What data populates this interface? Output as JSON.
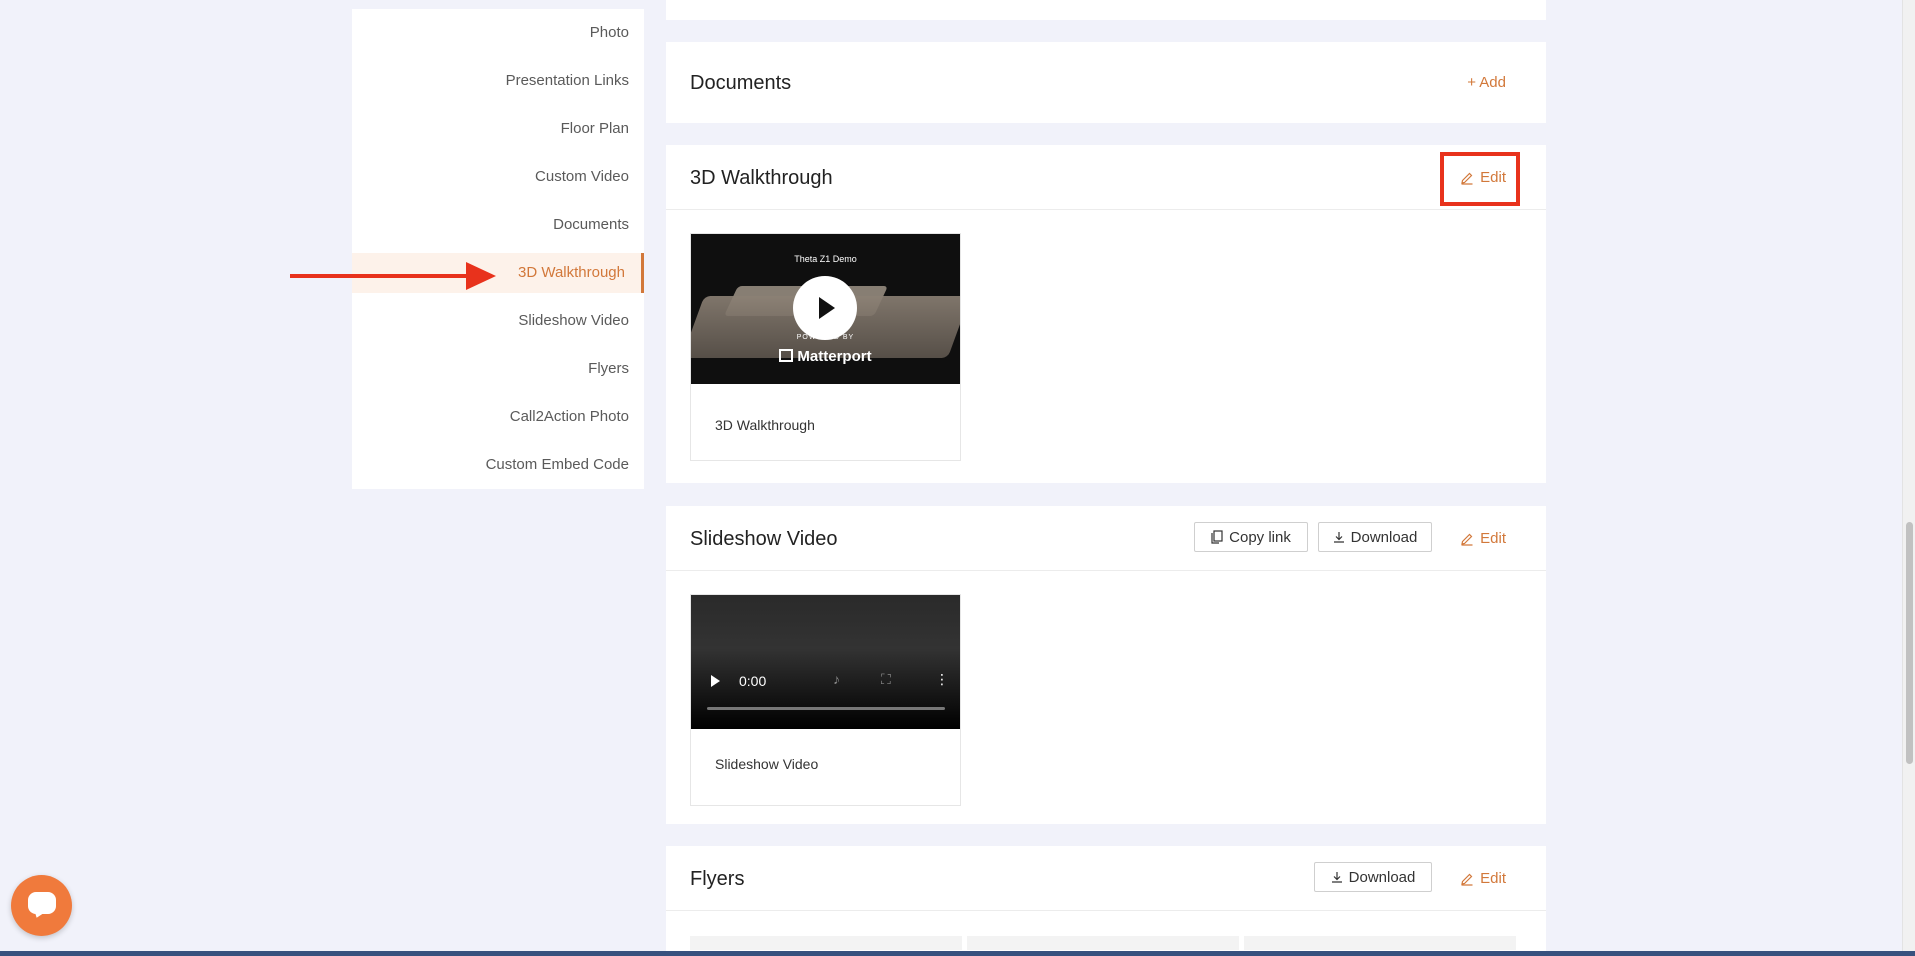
{
  "sidebar": {
    "items": [
      {
        "label": "Photo"
      },
      {
        "label": "Presentation Links"
      },
      {
        "label": "Floor Plan"
      },
      {
        "label": "Custom Video"
      },
      {
        "label": "Documents"
      },
      {
        "label": "3D Walkthrough",
        "active": true
      },
      {
        "label": "Slideshow Video"
      },
      {
        "label": "Flyers"
      },
      {
        "label": "Call2Action Photo"
      },
      {
        "label": "Custom Embed Code"
      }
    ]
  },
  "documents": {
    "title": "Documents",
    "add_label": "+ Add"
  },
  "walkthrough": {
    "title": "3D Walkthrough",
    "edit_label": "Edit",
    "thumb_title": "Theta Z1 Demo",
    "powered_label": "POWERED BY",
    "brand_label": "Matterport",
    "caption": "3D Walkthrough"
  },
  "slideshow": {
    "title": "Slideshow Video",
    "copy_link_label": "Copy link",
    "download_label": "Download",
    "edit_label": "Edit",
    "video_time": "0:00",
    "caption": "Slideshow Video"
  },
  "flyers": {
    "title": "Flyers",
    "download_label": "Download",
    "edit_label": "Edit"
  },
  "colors": {
    "accent": "#d2783a",
    "annotation": "#e8321c",
    "background": "#f1f2fa"
  }
}
